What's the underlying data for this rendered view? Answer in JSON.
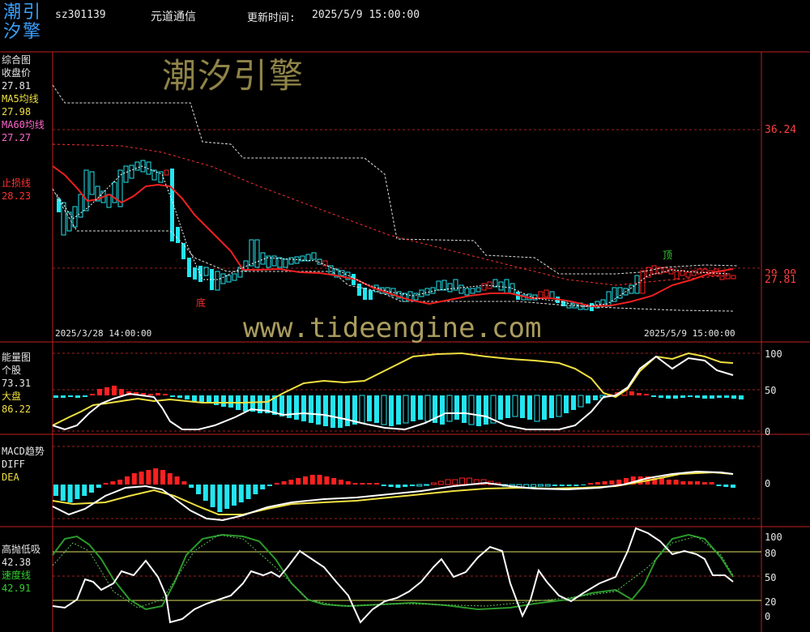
{
  "header": {
    "logo_line1": "潮引",
    "logo_line2": "汐擎",
    "code": "sz301139",
    "name": "元道通信",
    "update_label": "更新时间:",
    "update_time": "2025/5/9 15:00:00"
  },
  "main": {
    "title": "综合图",
    "close_label": "收盘价",
    "close_value": "27.81",
    "ma5_label": "MA5均线",
    "ma5_value": "27.98",
    "ma60_label": "MA60均线",
    "ma60_value": "27.27",
    "stop_label": "止损线",
    "stop_value": "28.23",
    "axis_high": "36.24",
    "axis_mid": "29.90",
    "axis_price": "27.81",
    "marker_bottom": "底",
    "marker_top": "顶",
    "date_start": "2025/3/28 14:00:00",
    "date_end": "2025/5/9 15:00:00",
    "watermark": "潮汐引擎",
    "url_watermark": "www.tideengine.com"
  },
  "energy": {
    "title": "能量图",
    "stock_label": "个股",
    "stock_value": "73.31",
    "market_label": "大盘",
    "market_value": "86.22",
    "ticks": [
      "100",
      "50",
      "0"
    ]
  },
  "macd": {
    "title": "MACD趋势",
    "diff_label": "DIFF",
    "dea_label": "DEA",
    "ticks": [
      "0"
    ]
  },
  "oscillator": {
    "title": "高抛低吸",
    "value1": "42.38",
    "speed_label": "速度线",
    "speed_value": "42.91",
    "ticks": [
      "100",
      "80",
      "50",
      "20",
      "0"
    ]
  },
  "colors": {
    "up": "#ff2020",
    "down": "#22e6f0",
    "ma": "#ff2020",
    "energy_stock": "#ffffff",
    "energy_market": "#f0e040",
    "speed": "#30a030"
  }
}
